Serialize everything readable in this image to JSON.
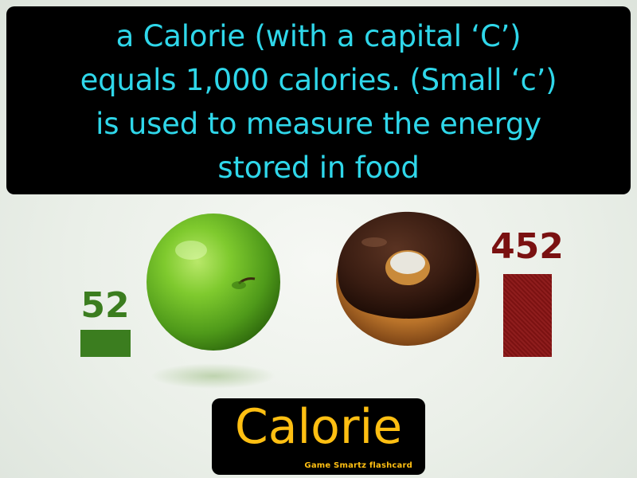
{
  "definition": {
    "lines": [
      "a Calorie (with a capital ‘C’)",
      "equals 1,000 calories. (Small ‘c’)",
      "is used to measure the energy",
      "stored in food"
    ]
  },
  "comparison": {
    "apple": {
      "value": "52",
      "amount": 52,
      "color": "#3b7d1f"
    },
    "donut": {
      "value": "452",
      "amount": 452,
      "color": "#8a1414"
    }
  },
  "term": {
    "title": "Calorie"
  },
  "credit": "Game Smartz  flashcard"
}
